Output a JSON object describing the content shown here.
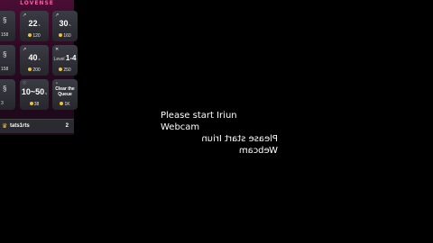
{
  "overlay": {
    "brand": "LOVENSE",
    "rows": [
      {
        "edge": {
          "icon": "pattern-icon",
          "value": "158"
        },
        "c1": {
          "level": "22",
          "unit": "s",
          "tokens": "120"
        },
        "c2": {
          "level": "30",
          "unit": "s",
          "tokens": "160"
        }
      },
      {
        "edge": {
          "icon": "pattern-icon",
          "value": "158"
        },
        "c1": {
          "level": "40",
          "unit": "s",
          "tokens": "200"
        },
        "c2": {
          "label_prefix": "Level",
          "label_value": "1-4",
          "tokens": "250"
        }
      },
      {
        "edge": {
          "icon": "pattern-icon",
          "value": "3"
        },
        "c1": {
          "level": "10~50",
          "unit": "s",
          "tokens": "38"
        },
        "c2": {
          "queue_label": "Clear the Queue",
          "tokens": "1K"
        }
      }
    ],
    "footer": {
      "username": "tats1rts",
      "count": "2"
    }
  },
  "message": {
    "line1": "Please start Iriun Webcam",
    "line2": "Please start Iriun Webcam"
  },
  "colors": {
    "brand": "#ff5aa5",
    "coin": "#f2c230",
    "panel": "#4a0d34"
  }
}
